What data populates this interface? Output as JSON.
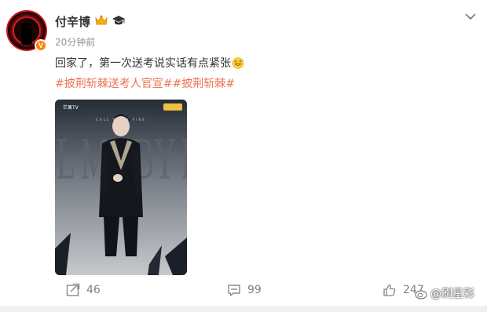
{
  "user": {
    "name": "付辛博",
    "timestamp": "20分钟前",
    "verified_mark": "V"
  },
  "post": {
    "text": "回家了，第一次送考说实话有点紧张",
    "emoji": "emoji-grin-sweat",
    "hashtags": [
      "#披荆斩棘送考人官宣#",
      "#披荆斩棘#"
    ]
  },
  "image": {
    "logo_text": "芒果TV",
    "top_caption": "CALL ME BY FIRE",
    "big_title": "CALL ME BY FIRE"
  },
  "actions": {
    "share_count": "46",
    "comment_count": "99",
    "like_count": "247"
  },
  "watermark": {
    "text": "@刷星彩"
  },
  "colors": {
    "accent": "#eb7350",
    "verified": "#ff8200",
    "text": "#333333",
    "muted": "#939393"
  }
}
